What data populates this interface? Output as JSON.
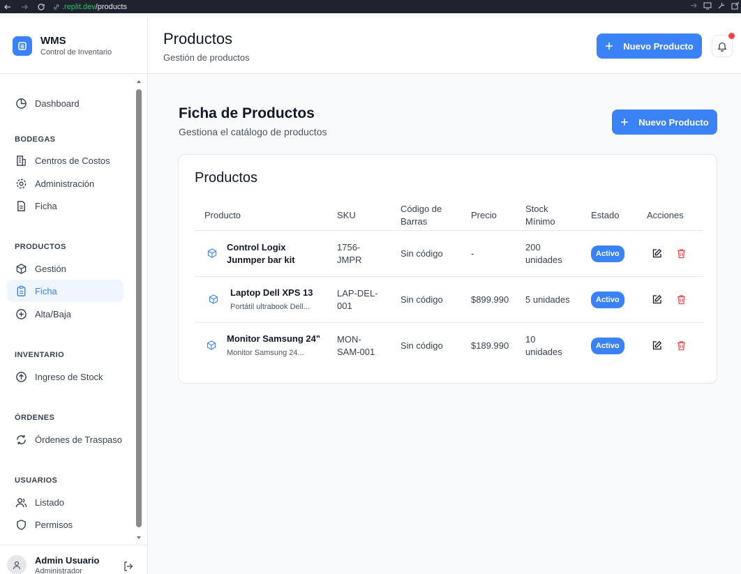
{
  "browser": {
    "url_host": ".replit.dev",
    "url_path": "/products"
  },
  "brand": {
    "title": "WMS",
    "subtitle": "Control de Inventario"
  },
  "sidebar": {
    "items": [
      {
        "label": "Dashboard",
        "icon": "pie-chart-icon"
      },
      {
        "section": "BODEGAS"
      },
      {
        "label": "Centros de Costos",
        "icon": "building-icon"
      },
      {
        "label": "Administración",
        "icon": "gear-icon"
      },
      {
        "label": "Ficha",
        "icon": "document-icon"
      },
      {
        "section": "PRODUCTOS"
      },
      {
        "label": "Gestión",
        "icon": "package-icon"
      },
      {
        "label": "Ficha",
        "icon": "clipboard-icon",
        "active": true
      },
      {
        "label": "Alta/Baja",
        "icon": "plus-circle-icon"
      },
      {
        "section": "INVENTARIO"
      },
      {
        "label": "Ingreso de Stock",
        "icon": "arrow-up-circle-icon"
      },
      {
        "section": "ÓRDENES"
      },
      {
        "label": "Órdenes de Traspaso",
        "icon": "refresh-icon"
      },
      {
        "section": "USUARIOS"
      },
      {
        "label": "Listado",
        "icon": "users-icon"
      },
      {
        "label": "Permisos",
        "icon": "shield-icon"
      }
    ],
    "user": {
      "name": "Admin Usuario",
      "role": "Administrador"
    }
  },
  "header": {
    "title": "Productos",
    "subtitle": "Gestión de productos",
    "new_button": "Nuevo Producto"
  },
  "main": {
    "title": "Ficha de Productos",
    "subtitle": "Gestiona el catálogo de productos",
    "new_button": "Nuevo Producto",
    "card_title": "Productos",
    "columns": [
      "Producto",
      "SKU",
      "Código de Barras",
      "Precio",
      "Stock Mínimo",
      "Estado",
      "Acciones"
    ],
    "rows": [
      {
        "name": "Control Logix Junmper bar kit",
        "description": "",
        "sku": "1756-JMPR",
        "barcode": "Sin código",
        "price": "-",
        "min_stock": "200 unidades",
        "status": "Activo"
      },
      {
        "name": "Laptop Dell XPS 13",
        "description": "Portátil ultrabook Dell...",
        "sku": "LAP-DEL-001",
        "barcode": "Sin código",
        "price": "$899.990",
        "min_stock": "5 unidades",
        "status": "Activo"
      },
      {
        "name": "Monitor Samsung 24\"",
        "description": "Monitor Samsung 24...",
        "sku": "MON-SAM-001",
        "barcode": "Sin código",
        "price": "$189.990",
        "min_stock": "10 unidades",
        "status": "Activo"
      }
    ]
  },
  "colors": {
    "accent": "#3b82f6",
    "danger": "#ef4444",
    "text": "#111827",
    "muted": "#4b5563"
  }
}
